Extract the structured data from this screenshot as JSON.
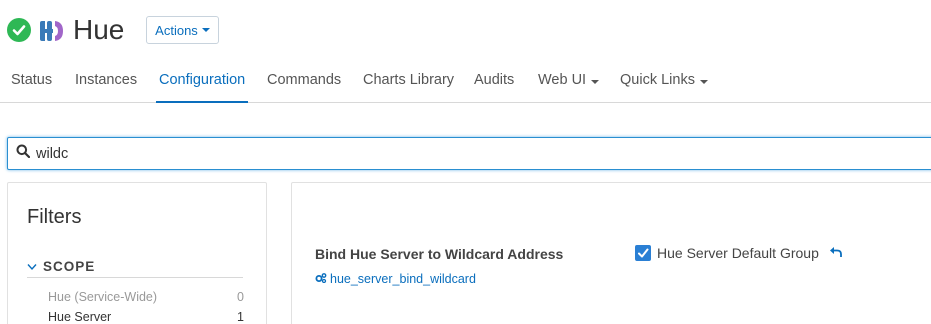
{
  "header": {
    "service_name": "Hue",
    "actions_label": "Actions",
    "status": "good-health",
    "status_color": "#2eb855"
  },
  "tabs": [
    {
      "label": "Status",
      "active": false
    },
    {
      "label": "Instances",
      "active": false
    },
    {
      "label": "Configuration",
      "active": true
    },
    {
      "label": "Commands",
      "active": false
    },
    {
      "label": "Charts Library",
      "active": false
    },
    {
      "label": "Audits",
      "active": false
    },
    {
      "label": "Web UI",
      "active": false,
      "dropdown": true
    },
    {
      "label": "Quick Links",
      "active": false,
      "dropdown": true
    }
  ],
  "search": {
    "value": "wildc",
    "icon": "search-icon"
  },
  "filters": {
    "title": "Filters",
    "scope_label": "SCOPE",
    "items": [
      {
        "label": "Hue (Service-Wide)",
        "count": "0"
      },
      {
        "label": "Hue Server",
        "count": "1"
      }
    ]
  },
  "property": {
    "display_name": "Bind Hue Server to Wildcard Address",
    "key": "hue_server_bind_wildcard",
    "scope_value": "Hue Server Default Group",
    "checked": true
  },
  "colors": {
    "accent": "#0a6ebd",
    "checkbox": "#2a7fd4"
  }
}
